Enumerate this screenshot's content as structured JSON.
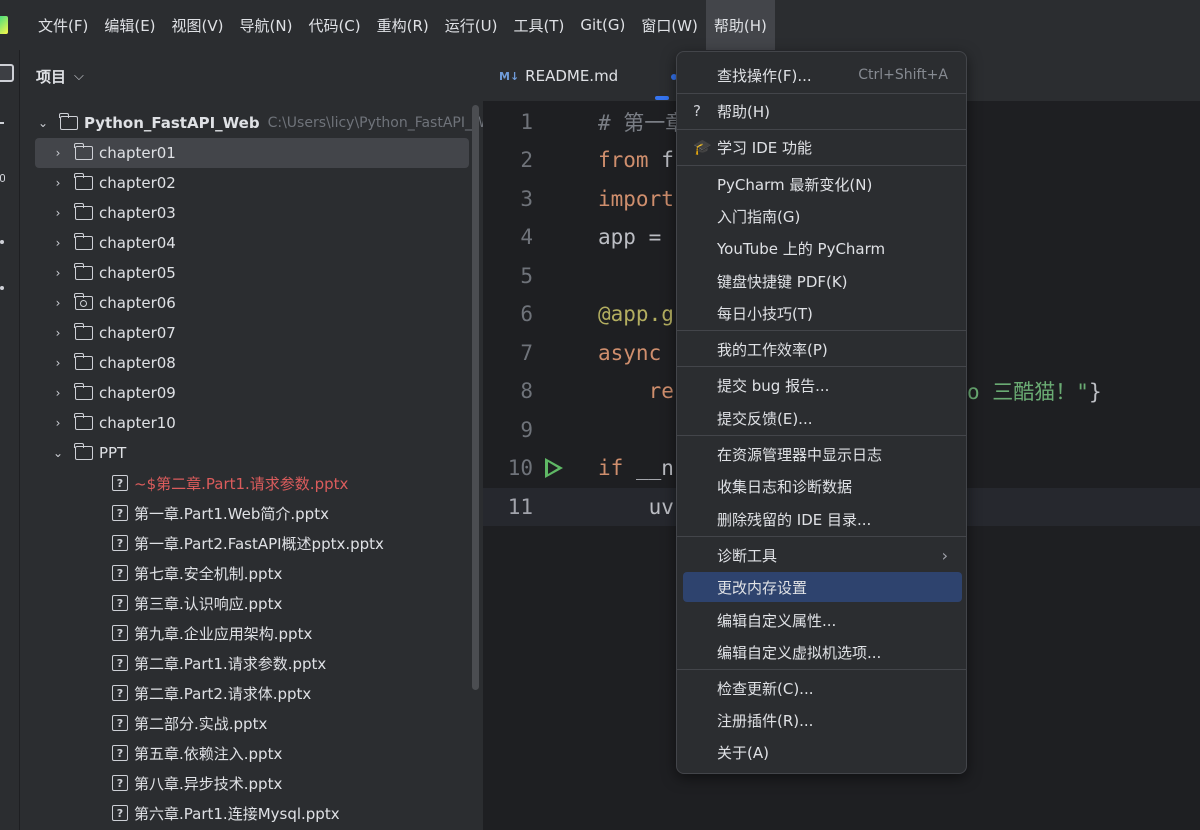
{
  "menubar": {
    "items": [
      "文件(F)",
      "编辑(E)",
      "视图(V)",
      "导航(N)",
      "代码(C)",
      "重构(R)",
      "运行(U)",
      "工具(T)",
      "Git(G)",
      "窗口(W)",
      "帮助(H)"
    ],
    "active": "帮助(H)"
  },
  "project": {
    "title": "项目",
    "root": {
      "name": "Python_FastAPI_Web",
      "path": "C:\\Users\\licy\\Python_FastAPI_Web"
    },
    "folders": [
      "chapter01",
      "chapter02",
      "chapter03",
      "chapter04",
      "chapter05",
      "chapter06",
      "chapter07",
      "chapter08",
      "chapter09",
      "chapter10"
    ],
    "ppt_folder": "PPT",
    "files": [
      "~$第二章.Part1.请求参数.pptx",
      "第一章.Part1.Web简介.pptx",
      "第一章.Part2.FastAPI概述pptx.pptx",
      "第七章.安全机制.pptx",
      "第三章.认识响应.pptx",
      "第九章.企业应用架构.pptx",
      "第二章.Part1.请求参数.pptx",
      "第二章.Part2.请求体.pptx",
      "第二部分.实战.pptx",
      "第五章.依赖注入.pptx",
      "第八章.异步技术.pptx",
      "第六章.Part1.连接Mysql.pptx"
    ]
  },
  "editor": {
    "tab": {
      "icon": "M↓",
      "label": "README.md"
    },
    "lines": [
      {
        "n": "1",
        "parts": [
          {
            "c": "cm",
            "t": "# 第一章"
          }
        ]
      },
      {
        "n": "2",
        "parts": [
          {
            "c": "kw",
            "t": "from"
          },
          {
            "c": "txt",
            "t": " f"
          }
        ]
      },
      {
        "n": "3",
        "parts": [
          {
            "c": "kw",
            "t": "import"
          }
        ]
      },
      {
        "n": "4",
        "parts": [
          {
            "c": "txt",
            "t": "app = "
          }
        ]
      },
      {
        "n": "5",
        "parts": []
      },
      {
        "n": "6",
        "parts": [
          {
            "c": "dec",
            "t": "@app.g"
          }
        ]
      },
      {
        "n": "7",
        "parts": [
          {
            "c": "kw",
            "t": "async"
          }
        ]
      },
      {
        "n": "8",
        "parts": [
          {
            "c": "kw",
            "t": "    re"
          }
        ]
      },
      {
        "n": "9",
        "parts": []
      },
      {
        "n": "10",
        "parts": [
          {
            "c": "kw",
            "t": "if"
          },
          {
            "c": "txt",
            "t": " __n"
          }
        ]
      },
      {
        "n": "11",
        "parts": [
          {
            "c": "txt",
            "t": "    uv"
          }
        ]
      }
    ],
    "line8_tail": {
      "str": "o 三酷猫！\"",
      "txt": "}"
    }
  },
  "help_menu": {
    "items": [
      {
        "label": "查找操作(F)...",
        "shortcut": "Ctrl+Shift+A"
      },
      {
        "label": "帮助(H)",
        "icon": "?"
      },
      {
        "label": "学习 IDE 功能",
        "icon": "🎓"
      },
      {
        "label": "PyCharm 最新变化(N)"
      },
      {
        "label": "入门指南(G)"
      },
      {
        "label": "YouTube 上的 PyCharm"
      },
      {
        "label": "键盘快捷键 PDF(K)"
      },
      {
        "label": "每日小技巧(T)"
      },
      {
        "label": "我的工作效率(P)"
      },
      {
        "label": "提交 bug 报告..."
      },
      {
        "label": "提交反馈(E)..."
      },
      {
        "label": "在资源管理器中显示日志"
      },
      {
        "label": "收集日志和诊断数据"
      },
      {
        "label": "删除残留的 IDE 目录..."
      },
      {
        "label": "诊断工具",
        "submenu": "›"
      },
      {
        "label": "更改内存设置",
        "highlighted": true
      },
      {
        "label": "编辑自定义属性..."
      },
      {
        "label": "编辑自定义虚拟机选项..."
      },
      {
        "label": "检查更新(C)..."
      },
      {
        "label": "注册插件(R)..."
      },
      {
        "label": "关于(A)"
      }
    ]
  },
  "colors": {
    "highlight": "#2e436e",
    "background": "#1e1f22",
    "panel": "#2b2d30"
  }
}
